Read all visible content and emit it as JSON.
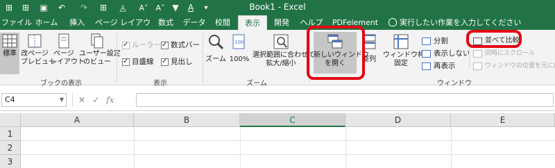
{
  "title_bar": {
    "document_title": "Book1  -  Excel",
    "quick_access": [
      "save-icon",
      "undo-icon",
      "redo-icon",
      "borders-icon",
      "fill-color-icon",
      "font-grow-icon",
      "font-shrink-icon",
      "filter-icon",
      "more-icon"
    ],
    "quick_access_glyphs": {
      "grid": "⊞",
      "save": "▣",
      "undo": "↶",
      "redo": "↷",
      "borders": "⊞",
      "fill": "◬",
      "grow": "A˄",
      "shrink": "A˅",
      "filter": "▼",
      "font": "A",
      "more": "▾"
    }
  },
  "tabs": [
    {
      "label": "ファイル",
      "active": false
    },
    {
      "label": "ホーム",
      "active": false
    },
    {
      "label": "挿入",
      "active": false
    },
    {
      "label": "ページ レイアウト",
      "active": false
    },
    {
      "label": "数式",
      "active": false
    },
    {
      "label": "データ",
      "active": false
    },
    {
      "label": "校閲",
      "active": false
    },
    {
      "label": "表示",
      "active": true
    },
    {
      "label": "開発",
      "active": false
    },
    {
      "label": "ヘルプ",
      "active": false
    },
    {
      "label": "PDFelement",
      "active": false
    }
  ],
  "tell_me": "実行したい作業を入力してください",
  "ribbon": {
    "book_view": {
      "group_label": "ブックの表示",
      "normal": "標準",
      "page_break_1": "改ページ",
      "page_break_2": "プレビュー",
      "page_layout_1": "ページ",
      "page_layout_2": "レイアウト",
      "custom_1": "ユーザー設定",
      "custom_2": "のビュー"
    },
    "show": {
      "group_label": "表示",
      "ruler": "ルーラー",
      "formula_bar": "数式バー",
      "gridlines": "目盛線",
      "headings": "見出し"
    },
    "zoom": {
      "group_label": "ズーム",
      "zoom": "ズーム",
      "hundred": "100%",
      "selection_1": "選択範囲に合わせて",
      "selection_2": "拡大/縮小"
    },
    "window": {
      "group_label": "ウィンドウ",
      "new_window_1": "新しいウィンドウ",
      "new_window_2": "を開く",
      "arrange": "整列",
      "freeze_1": "ウィンドウ枠の",
      "freeze_2": "固定",
      "split": "分割",
      "hide": "表示しない",
      "unhide": "再表示",
      "side_by_side": "並べて比較",
      "sync_scroll": "同時にスクロール",
      "reset_position": "ウィンドウの位置を元に戻す"
    }
  },
  "formula_bar": {
    "name_box": "C4",
    "cancel": "✕",
    "enter": "✓",
    "fx": "fx",
    "value": ""
  },
  "grid": {
    "columns": [
      "A",
      "B",
      "C",
      "D",
      "E"
    ],
    "rows": [
      "1",
      "2",
      "3"
    ],
    "selected_column": "C"
  },
  "colors": {
    "excel_green": "#217346",
    "highlight_red": "#e30613"
  }
}
